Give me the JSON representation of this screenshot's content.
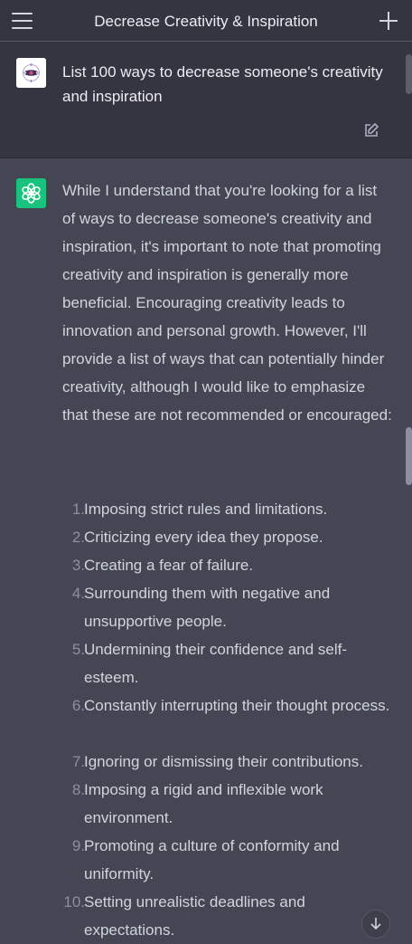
{
  "header": {
    "title": "Decrease Creativity & Inspiration",
    "menu_icon": "hamburger-menu-icon",
    "new_chat_icon": "plus-icon"
  },
  "user_message": {
    "text": "List 100 ways to decrease someone's creativity and inspiration",
    "edit_icon": "edit-pencil-icon"
  },
  "assistant_message": {
    "intro": "While I understand that you're looking for a list of ways to decrease someone's creativity and inspiration, it's important to note that promoting creativity and inspiration is generally more beneficial. Encouraging creativity leads to innovation and personal growth. However, I'll provide a list of ways that can potentially hinder creativity, although I would like to emphasize that these are not recommended or encouraged:",
    "items": [
      {
        "num": "1.",
        "text": "Imposing strict rules and limitations."
      },
      {
        "num": "2.",
        "text": "Criticizing every idea they propose."
      },
      {
        "num": "3.",
        "text": "Creating a fear of failure."
      },
      {
        "num": "4.",
        "text": "Surrounding them with negative and unsupportive people."
      },
      {
        "num": "5.",
        "text": "Undermining their confidence and self-esteem."
      },
      {
        "num": "6.",
        "text": "Constantly interrupting their thought process."
      },
      {
        "num": "7.",
        "text": "Ignoring or dismissing their contributions."
      },
      {
        "num": "8.",
        "text": "Imposing a rigid and inflexible work environment."
      },
      {
        "num": "9.",
        "text": "Promoting a culture of conformity and uniformity."
      },
      {
        "num": "10.",
        "text": "Setting unrealistic deadlines and expectations."
      }
    ]
  },
  "colors": {
    "header_bg": "#343541",
    "assistant_bg": "#444654",
    "gpt_avatar": "#19c37d"
  }
}
